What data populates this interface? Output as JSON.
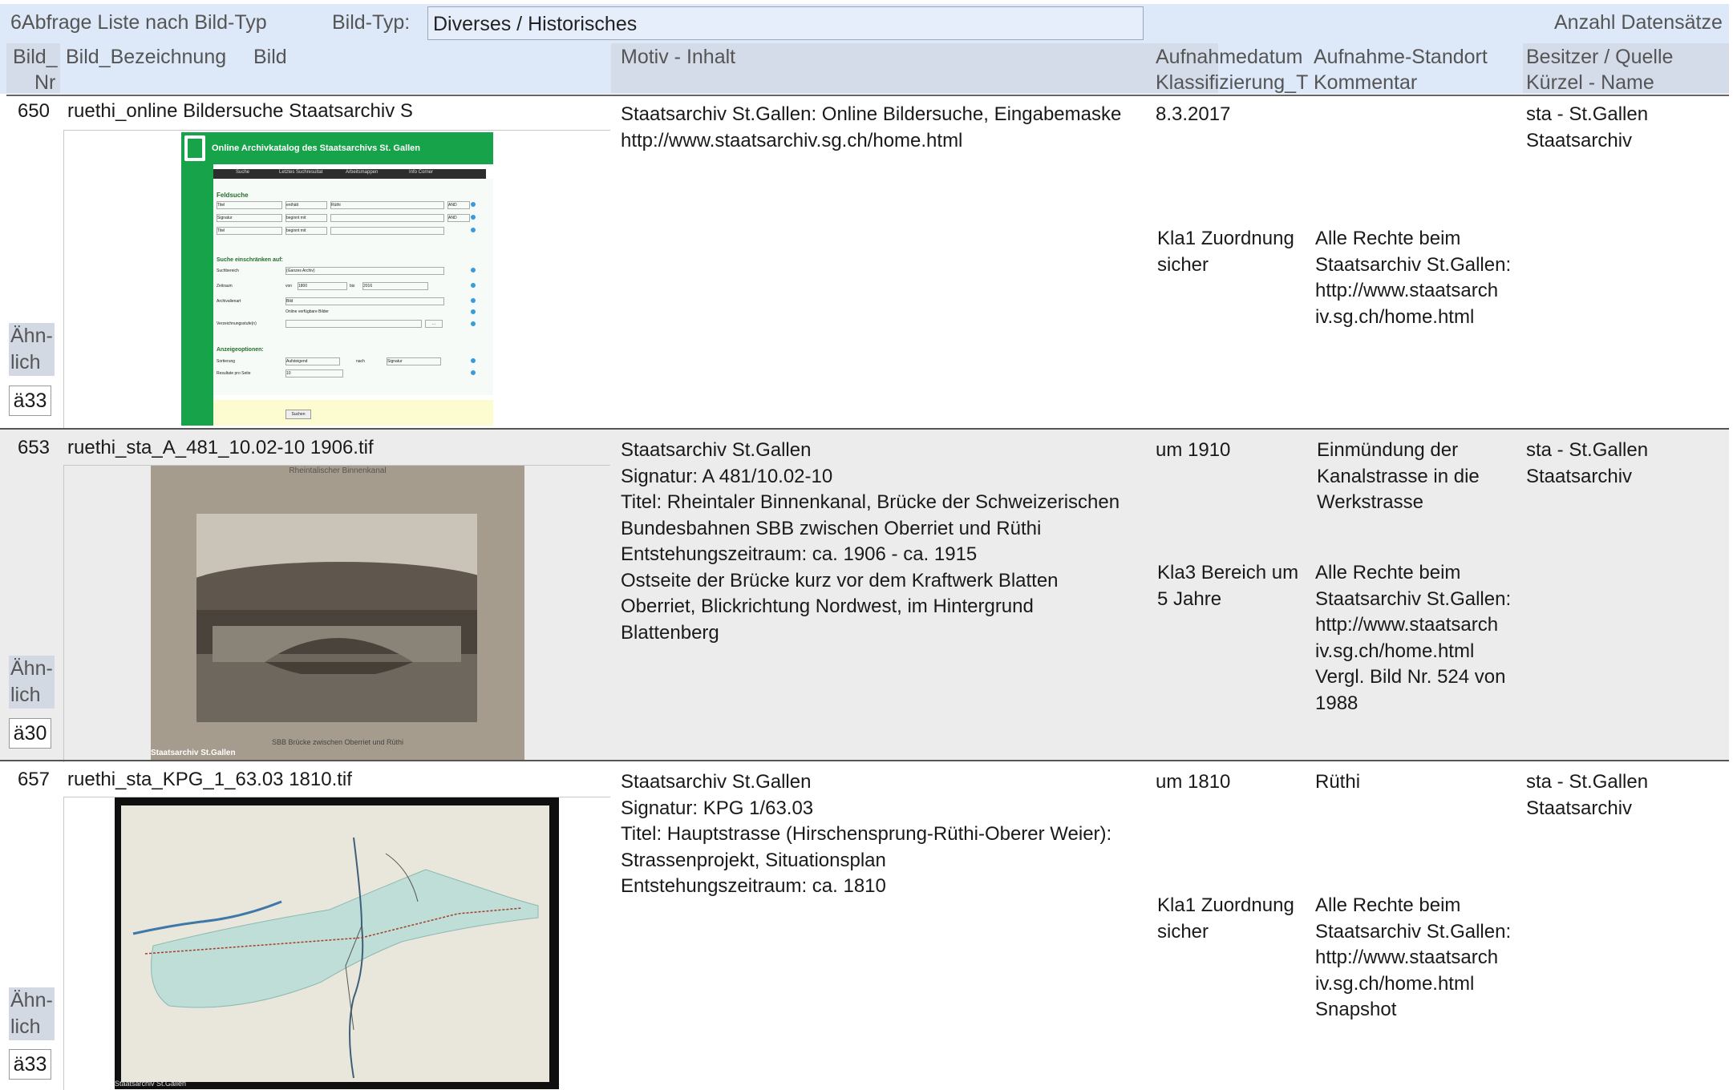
{
  "header": {
    "title": "6Abfrage Liste nach Bild-Typ",
    "filter_label": "Bild-Typ:",
    "filter_value": "Diverses / Historisches",
    "count_label": "Anzahl Datensätze",
    "columns": {
      "nr_1": "Bild_",
      "nr_2": "Nr",
      "bezeichnung": "Bild_Bezeichnung",
      "bild": "Bild",
      "motiv": "Motiv - Inhalt",
      "datum_1": "Aufnahmedatum",
      "datum_2": "Klassifizierung_T",
      "standort_1": "Aufnahme-Standort",
      "standort_2": "Kommentar",
      "besitzer_1": "Besitzer / Quelle",
      "besitzer_2": "Kürzel - Name"
    }
  },
  "records": [
    {
      "nr": "650",
      "bezeichnung": "ruethi_online Bildersuche Staatsarchiv S",
      "motiv": "Staatsarchiv St.Gallen: Online Bildersuche, Eingabemaske\nhttp://www.staatsarchiv.sg.ch/home.html",
      "datum": "8.3.2017",
      "standort": "",
      "besitzer": "sta - St.Gallen\nStaatsarchiv",
      "klassifizierung": "Kla1 Zuordnung\nsicher",
      "kommentar": "Alle Rechte beim\nStaatsarchiv St.Gallen:\nhttp://www.staatsarch\niv.sg.ch/home.html",
      "aehnlich_label": "Ähn-\nlich",
      "aehnlich_value": "ä33",
      "thumb": {
        "title": "Online Archivkatalog des Staatsarchivs St. Gallen",
        "tabs": [
          "Suche",
          "Letztes Suchresultat",
          "Arbeitsmappen",
          "Info Corner"
        ],
        "section1": "Feldsuche",
        "f1": [
          "Titel",
          "enthält",
          "Rüthi",
          "AND"
        ],
        "f2": [
          "Signatur",
          "beginnt mit",
          "",
          "AND"
        ],
        "f3": [
          "Titel",
          "beginnt mit",
          ""
        ],
        "section2": "Suche einschränken auf:",
        "suchbereich_label": "Suchbereich",
        "suchbereich_value": "(Ganzes Archiv)",
        "zeitraum_label": "Zeitraum",
        "von": "von",
        "von_value": "1800",
        "bis": "bis",
        "bis_value": "2016",
        "archivalienart_label": "Archivalienart",
        "archivalienart_value": "Bild",
        "online_label": "Online verfügbare Bilder",
        "verzeichnung_label": "Verzeichnungsstufe(n)",
        "dots": "...",
        "section3": "Anzeigeoptionen:",
        "sortierung_label": "Sortierung",
        "sortierung_value": "Aufsteigend",
        "nach": "nach",
        "nach_value": "Signatur",
        "resultate_label": "Resultate pro Seite",
        "resultate_value": "10",
        "button": "Suchen"
      }
    },
    {
      "nr": "653",
      "bezeichnung": "ruethi_sta_A_481_10.02-10 1906.tif",
      "motiv": "Staatsarchiv St.Gallen\nSignatur: A 481/10.02-10\nTitel: Rheintaler Binnenkanal, Brücke der Schweizerischen\nBundesbahnen SBB zwischen Oberriet und Rüthi\nEntstehungszeitraum: ca. 1906 - ca. 1915\nOstseite der Brücke kurz vor dem Kraftwerk Blatten\nOberriet, Blickrichtung Nordwest, im Hintergrund\nBlattenberg",
      "datum": "um 1910",
      "standort": "Einmündung der\nKanalstrasse in die\nWerkstrasse",
      "besitzer": "sta - St.Gallen\nStaatsarchiv",
      "klassifizierung": "Kla3 Bereich um\n5 Jahre",
      "kommentar": "Alle Rechte beim\nStaatsarchiv St.Gallen:\nhttp://www.staatsarch\niv.sg.ch/home.html\nVergl. Bild Nr. 524 von\n1988",
      "aehnlich_label": "Ähn-\nlich",
      "aehnlich_value": "ä30",
      "thumb": {
        "caption_top": "Rheintalischer Binnenkanal",
        "caption_bottom": "SBB Brücke zwischen Oberriet und Rüthi",
        "watermark": "Staatsarchiv St.Gallen"
      }
    },
    {
      "nr": "657",
      "bezeichnung": "ruethi_sta_KPG_1_63.03 1810.tif",
      "motiv": "Staatsarchiv St.Gallen\nSignatur: KPG 1/63.03\nTitel: Hauptstrasse (Hirschensprung-Rüthi-Oberer Weier):\nStrassenprojekt, Situationsplan\nEntstehungszeitraum: ca. 1810",
      "datum": "um 1810",
      "standort": "Rüthi",
      "besitzer": "sta - St.Gallen\nStaatsarchiv",
      "klassifizierung": "Kla1 Zuordnung\nsicher",
      "kommentar": "Alle Rechte beim\nStaatsarchiv St.Gallen:\nhttp://www.staatsarch\niv.sg.ch/home.html\nSnapshot",
      "aehnlich_label": "Ähn-\nlich",
      "aehnlich_value": "ä33",
      "thumb": {
        "watermark": "Staatsarchiv St.Gallen"
      }
    }
  ],
  "colors": {
    "header_band": "#dde8f8",
    "alt_row": "#ececec",
    "archive_green": "#16a34a"
  }
}
